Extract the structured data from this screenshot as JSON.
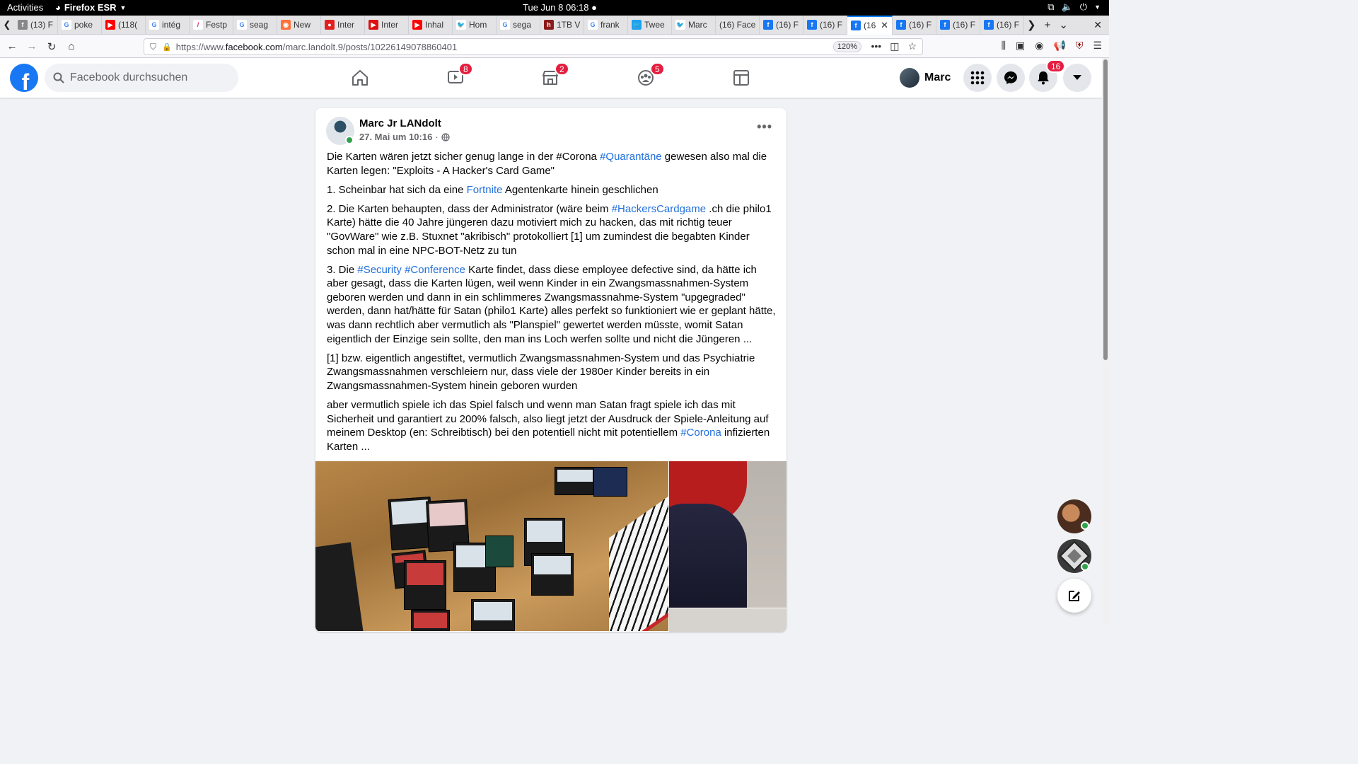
{
  "system": {
    "activities": "Activities",
    "app_name": "Firefox ESR",
    "clock": "Tue Jun 8  06:18"
  },
  "tabs": [
    {
      "label": "(13) F",
      "fav": "fb-gray"
    },
    {
      "label": "poke",
      "fav": "google"
    },
    {
      "label": "(118(",
      "fav": "youtube"
    },
    {
      "label": "intég",
      "fav": "google"
    },
    {
      "label": "Festp",
      "fav": "slash"
    },
    {
      "label": "seag",
      "fav": "google"
    },
    {
      "label": "New",
      "fav": "firefox"
    },
    {
      "label": "Inter",
      "fav": "red-circle"
    },
    {
      "label": "Inter",
      "fav": "red-box"
    },
    {
      "label": "Inhal",
      "fav": "youtube"
    },
    {
      "label": "Hom",
      "fav": "twitter"
    },
    {
      "label": "sega",
      "fav": "google"
    },
    {
      "label": "1TB V",
      "fav": "h-brand"
    },
    {
      "label": "frank",
      "fav": "google"
    },
    {
      "label": "Twee",
      "fav": "twitter-box"
    },
    {
      "label": "Marc",
      "fav": "twitter"
    },
    {
      "label": "(16) Face",
      "fav": "none"
    },
    {
      "label": "(16) F",
      "fav": "facebook"
    },
    {
      "label": "(16) F",
      "fav": "facebook"
    },
    {
      "label": "(16",
      "fav": "facebook",
      "active": true
    },
    {
      "label": "(16) F",
      "fav": "facebook"
    },
    {
      "label": "(16) F",
      "fav": "facebook"
    },
    {
      "label": "(16) F",
      "fav": "facebook"
    }
  ],
  "browser": {
    "url_prefix": "https://www.",
    "url_domain": "facebook.com",
    "url_path": "/marc.landolt.9/posts/10226149078860401",
    "zoom": "120%"
  },
  "fb": {
    "search_placeholder": "Facebook durchsuchen",
    "watch_badge": "8",
    "marketplace_badge": "2",
    "groups_badge": "5",
    "profile_name": "Marc",
    "notifications_badge": "16"
  },
  "post": {
    "author": "Marc Jr LANdolt",
    "date": "27. Mai um 10:16",
    "p1": [
      {
        "t": "Die Karten wären jetzt sicher genug lange in der #Corona "
      },
      {
        "t": "#Quarantäne",
        "link": true
      },
      {
        "t": " gewesen also mal die Karten legen: \"Exploits - A Hacker's Card Game\""
      }
    ],
    "p2": [
      {
        "t": "1. Scheinbar hat sich da eine "
      },
      {
        "t": "Fortnite",
        "link": true
      },
      {
        "t": " Agentenkarte hinein geschlichen"
      }
    ],
    "p3": [
      {
        "t": "2. Die Karten behaupten, dass der Administrator (wäre beim "
      },
      {
        "t": "#HackersCardgame",
        "link": true
      },
      {
        "t": " .ch die philo1 Karte) hätte die 40 Jahre jüngeren dazu motiviert mich zu hacken, das mit richtig teuer \"GovWare\" wie z.B. Stuxnet \"akribisch\" protokolliert [1] um zumindest die begabten Kinder schon mal in eine NPC-BOT-Netz zu tun"
      }
    ],
    "p4": [
      {
        "t": "3. Die "
      },
      {
        "t": "#Security",
        "link": true
      },
      {
        "t": " "
      },
      {
        "t": "#Conference",
        "link": true
      },
      {
        "t": " Karte findet, dass diese employee defective sind, da hätte ich aber gesagt, dass die Karten lügen, weil wenn Kinder in ein Zwangsmassnahmen-System geboren werden und dann in ein schlimmeres Zwangsmassnahme-System \"upgegraded\" werden, dann hat/hätte für Satan (philo1 Karte) alles perfekt so funktioniert wie er geplant hätte, was dann rechtlich aber vermutlich als \"Planspiel\" gewertet werden müsste, womit Satan eigentlich der Einzige sein sollte, den man ins Loch werfen sollte und nicht die Jüngeren ..."
      }
    ],
    "p5": [
      {
        "t": "[1] bzw. eigentlich angestiftet, vermutlich Zwangsmassnahmen-System und das Psychiatrie Zwangsmassnahmen verschleiern nur, dass viele der 1980er Kinder bereits in ein Zwangsmassnahmen-System hinein geboren wurden"
      }
    ],
    "p6": [
      {
        "t": "aber vermutlich spiele ich das Spiel falsch und wenn man Satan fragt spiele ich das mit Sicherheit und garantiert zu 200% falsch, also liegt jetzt der Ausdruck der Spiele-Anleitung auf meinem Desktop (en: Schreibtisch) bei den potentiell nicht mit potentiellem "
      },
      {
        "t": "#Corona",
        "link": true
      },
      {
        "t": " infizierten Karten ..."
      }
    ]
  },
  "colors": {
    "fb_blue": "#1877f2",
    "link": "#216fdb",
    "badge": "#e41e3f",
    "online": "#31a24c"
  }
}
